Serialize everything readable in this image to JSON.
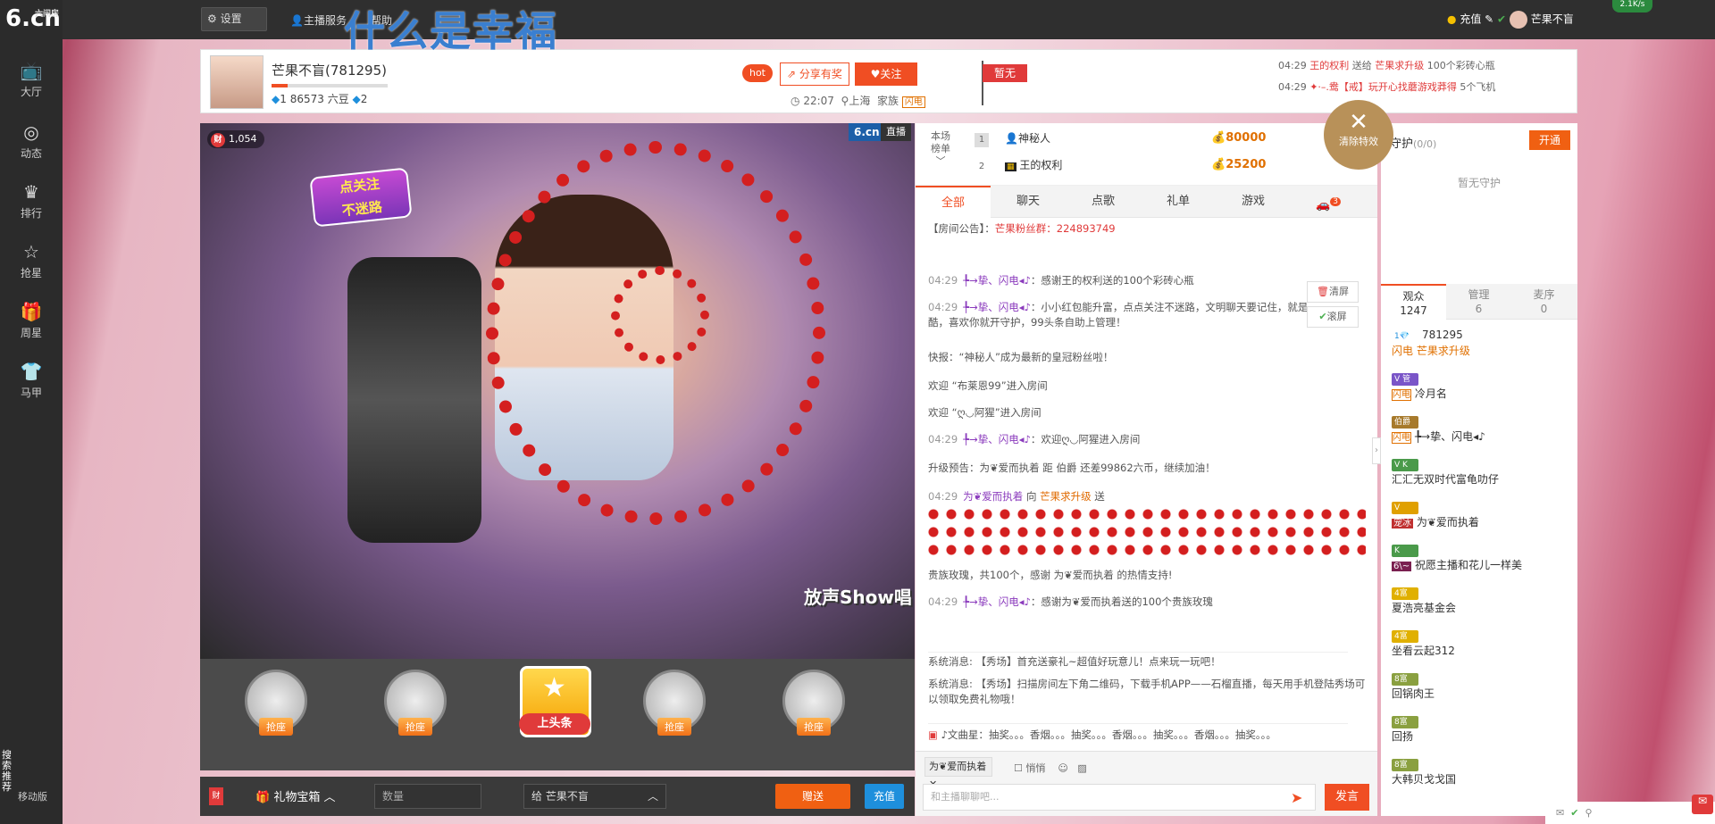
{
  "brand": {
    "logo_main": "6.cn",
    "logo_sub": "六间房"
  },
  "leftnav": {
    "items": [
      {
        "label": "大厅",
        "icon": "tv-icon",
        "glyph": "📺"
      },
      {
        "label": "动态",
        "icon": "compass-icon",
        "glyph": "◎"
      },
      {
        "label": "排行",
        "icon": "crown-icon",
        "glyph": "♛"
      },
      {
        "label": "抢星",
        "icon": "star-icon",
        "glyph": "☆"
      },
      {
        "label": "周星",
        "icon": "gift-icon",
        "glyph": "🎁"
      },
      {
        "label": "马甲",
        "icon": "shirt-icon",
        "glyph": "👕"
      }
    ],
    "bottom": {
      "search": "搜索推荐",
      "mobile": "移动版"
    }
  },
  "topbar": {
    "settings": "设置",
    "host_service": "主播服务",
    "help": "帮助",
    "overlay_title": "什么是幸福",
    "recharge": "充值",
    "username": "芒果不盲",
    "speed": "2.1K/s"
  },
  "host": {
    "name": "芒果不盲",
    "id_display": "(781295)",
    "level1": "1",
    "beans": "86573 六豆",
    "level2": "2",
    "hot": "hot",
    "share": "分享有奖",
    "follow": "关注",
    "time": "22:07",
    "city": "上海",
    "family": "家族",
    "family_badge": "闪电",
    "rank_flag": "暂无"
  },
  "gift_feed": [
    {
      "time": "04:29",
      "from": "王的权利",
      "verb": "送给",
      "to": "芒果求升级",
      "text": "100个彩砖心瓶"
    },
    {
      "time": "04:29",
      "from": "✦·–.鸯【戒】玩开心找蘑游戏莽得",
      "verb": "",
      "to": "",
      "text": "5个飞机"
    }
  ],
  "video": {
    "watch": "1,054",
    "watch_badge": "财",
    "logo": "6.cn",
    "live": "直播",
    "sticker_1": "点关注",
    "sticker_2": "不迷路",
    "show_logo": "放声Show唱"
  },
  "seats": {
    "seat_label": "抢座",
    "headline": "上头条"
  },
  "giftbar": {
    "cai": "财",
    "gift_box": "礼物宝箱",
    "qty_placeholder": "数量",
    "to_label": "给",
    "to_name": "芒果不盲",
    "send": "赠送",
    "recharge": "充值"
  },
  "rank": {
    "title_1": "本场",
    "title_2": "榜单",
    "rows": [
      {
        "n": "1",
        "name": "神秘人",
        "value": "80000"
      },
      {
        "n": "2",
        "name": "王的权利",
        "value": "25200"
      }
    ]
  },
  "chat_tabs": [
    {
      "label": "全部"
    },
    {
      "label": "聊天"
    },
    {
      "label": "点歌"
    },
    {
      "label": "礼单"
    },
    {
      "label": "游戏"
    }
  ],
  "car_count": "3",
  "chat": {
    "notice_label": "【房间公告】：",
    "notice": "芒果粉丝群：224893749",
    "m1": {
      "t": "04:29",
      "nm": "╄→挚、闪电◂♪",
      "x": "：感谢王的权利送的100个彩砖心瓶"
    },
    "m2": {
      "t": "04:29",
      "nm": "╄→挚、闪电◂♪",
      "x": "：小小红包能升富，点点关注不迷路，文明聊天要记住，就是酷，喜欢你就开守护，99头条自助上管理！"
    },
    "m3": "快报：“神秘人”成为最新的皇冠粉丝啦！",
    "m4": "欢迎 “布莱恩99”进入房间",
    "m5": "欢迎 “ღ◡阿猩”进入房间",
    "m6": {
      "t": "04:29",
      "nm": "╄→挚、闪电◂♪",
      "x": "：欢迎ღ◡阿猩进入房间"
    },
    "m7": "升级预告：为❦爱而执着 距 伯爵 还差99862六币，继续加油！",
    "m8": {
      "t": "04:29",
      "nm": "为❦爱而执着",
      "x": "向",
      "to": "芒果求升级",
      "y": "送"
    },
    "m9": "贵族玫瑰，共100个，感谢 为❦爱而执着 的热情支持!",
    "m10": {
      "t": "04:29",
      "nm": "╄→挚、闪电◂♪",
      "x": "：感谢为❦爱而执着送的100个贵族玫瑰"
    },
    "s1": "系统消息: 【秀场】首充送豪礼~超值好玩意儿！点来玩一玩吧！",
    "s2": "系统消息: 【秀场】扫描房间左下角二维码，下载手机APP——石榴直播，每天用手机登陆秀场可以领取免费礼物哦！",
    "marquee": "♪文曲星：抽奖。。。香烟。。。抽奖。。。香烟。。。抽奖。。。香烟。。。抽奖。。。",
    "clear": "清屏",
    "scroll": "滚屏",
    "clear_fx": "清除特效"
  },
  "input": {
    "to_user": "为❦爱而执着",
    "whisper": "悄悄",
    "placeholder": "和主播聊聊吧...",
    "post": "发言"
  },
  "guard": {
    "title": "守护",
    "count": "(0/0)",
    "open": "开通",
    "empty": "暂无守护"
  },
  "aud_tabs": [
    {
      "label": "观众",
      "n": "1247"
    },
    {
      "label": "管理",
      "n": "6"
    },
    {
      "label": "麦序",
      "n": "0"
    }
  ],
  "audience": [
    {
      "badge": "1💎",
      "name": "781295",
      "sub": "闪电 芒果求升级"
    },
    {
      "badge": "V 管",
      "name": "冷月名",
      "sub": "闪电"
    },
    {
      "badge": "伯爵",
      "name": "╄→挚、闪电◂♪",
      "sub": "闪电"
    },
    {
      "badge": "V K",
      "name": "汇汇无双时代富龟叻仔",
      "sub": ""
    },
    {
      "badge": "V",
      "name": "为❦爱而执着",
      "sub": "宠冰"
    },
    {
      "badge": "K",
      "name": "祝愿主播和花儿一样美",
      "sub": "6\\~"
    },
    {
      "badge": "4富",
      "name": "夏浩亮基金会",
      "sub": ""
    },
    {
      "badge": "4富",
      "name": "坐看云起312",
      "sub": ""
    },
    {
      "badge": "8富",
      "name": "回锅肉王",
      "sub": ""
    },
    {
      "badge": "8富",
      "name": "回扬",
      "sub": ""
    },
    {
      "badge": "8富",
      "name": "大韩贝戈戈国",
      "sub": ""
    }
  ]
}
